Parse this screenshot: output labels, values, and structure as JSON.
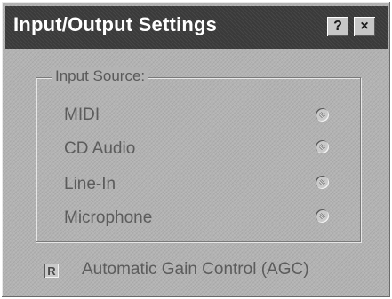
{
  "window": {
    "title": "Input/Output Settings",
    "help_glyph": "?",
    "close_glyph": "×"
  },
  "input_source": {
    "legend": "Input Source:",
    "options": [
      {
        "label": "MIDI",
        "icon": "radio-icon"
      },
      {
        "label": "CD Audio",
        "icon": "radio-icon"
      },
      {
        "label": "Line-In",
        "icon": "radio-icon"
      },
      {
        "label": "Microphone",
        "icon": "radio-icon"
      }
    ]
  },
  "agc": {
    "label": "Automatic Gain Control (AGC)",
    "check_glyph": "R"
  },
  "colors": {
    "window_bg": "#b3b3b3",
    "titlebar_bg": "#3a3a3a",
    "title_text": "#ffffff",
    "disabled_text": "#5c5c5c"
  }
}
